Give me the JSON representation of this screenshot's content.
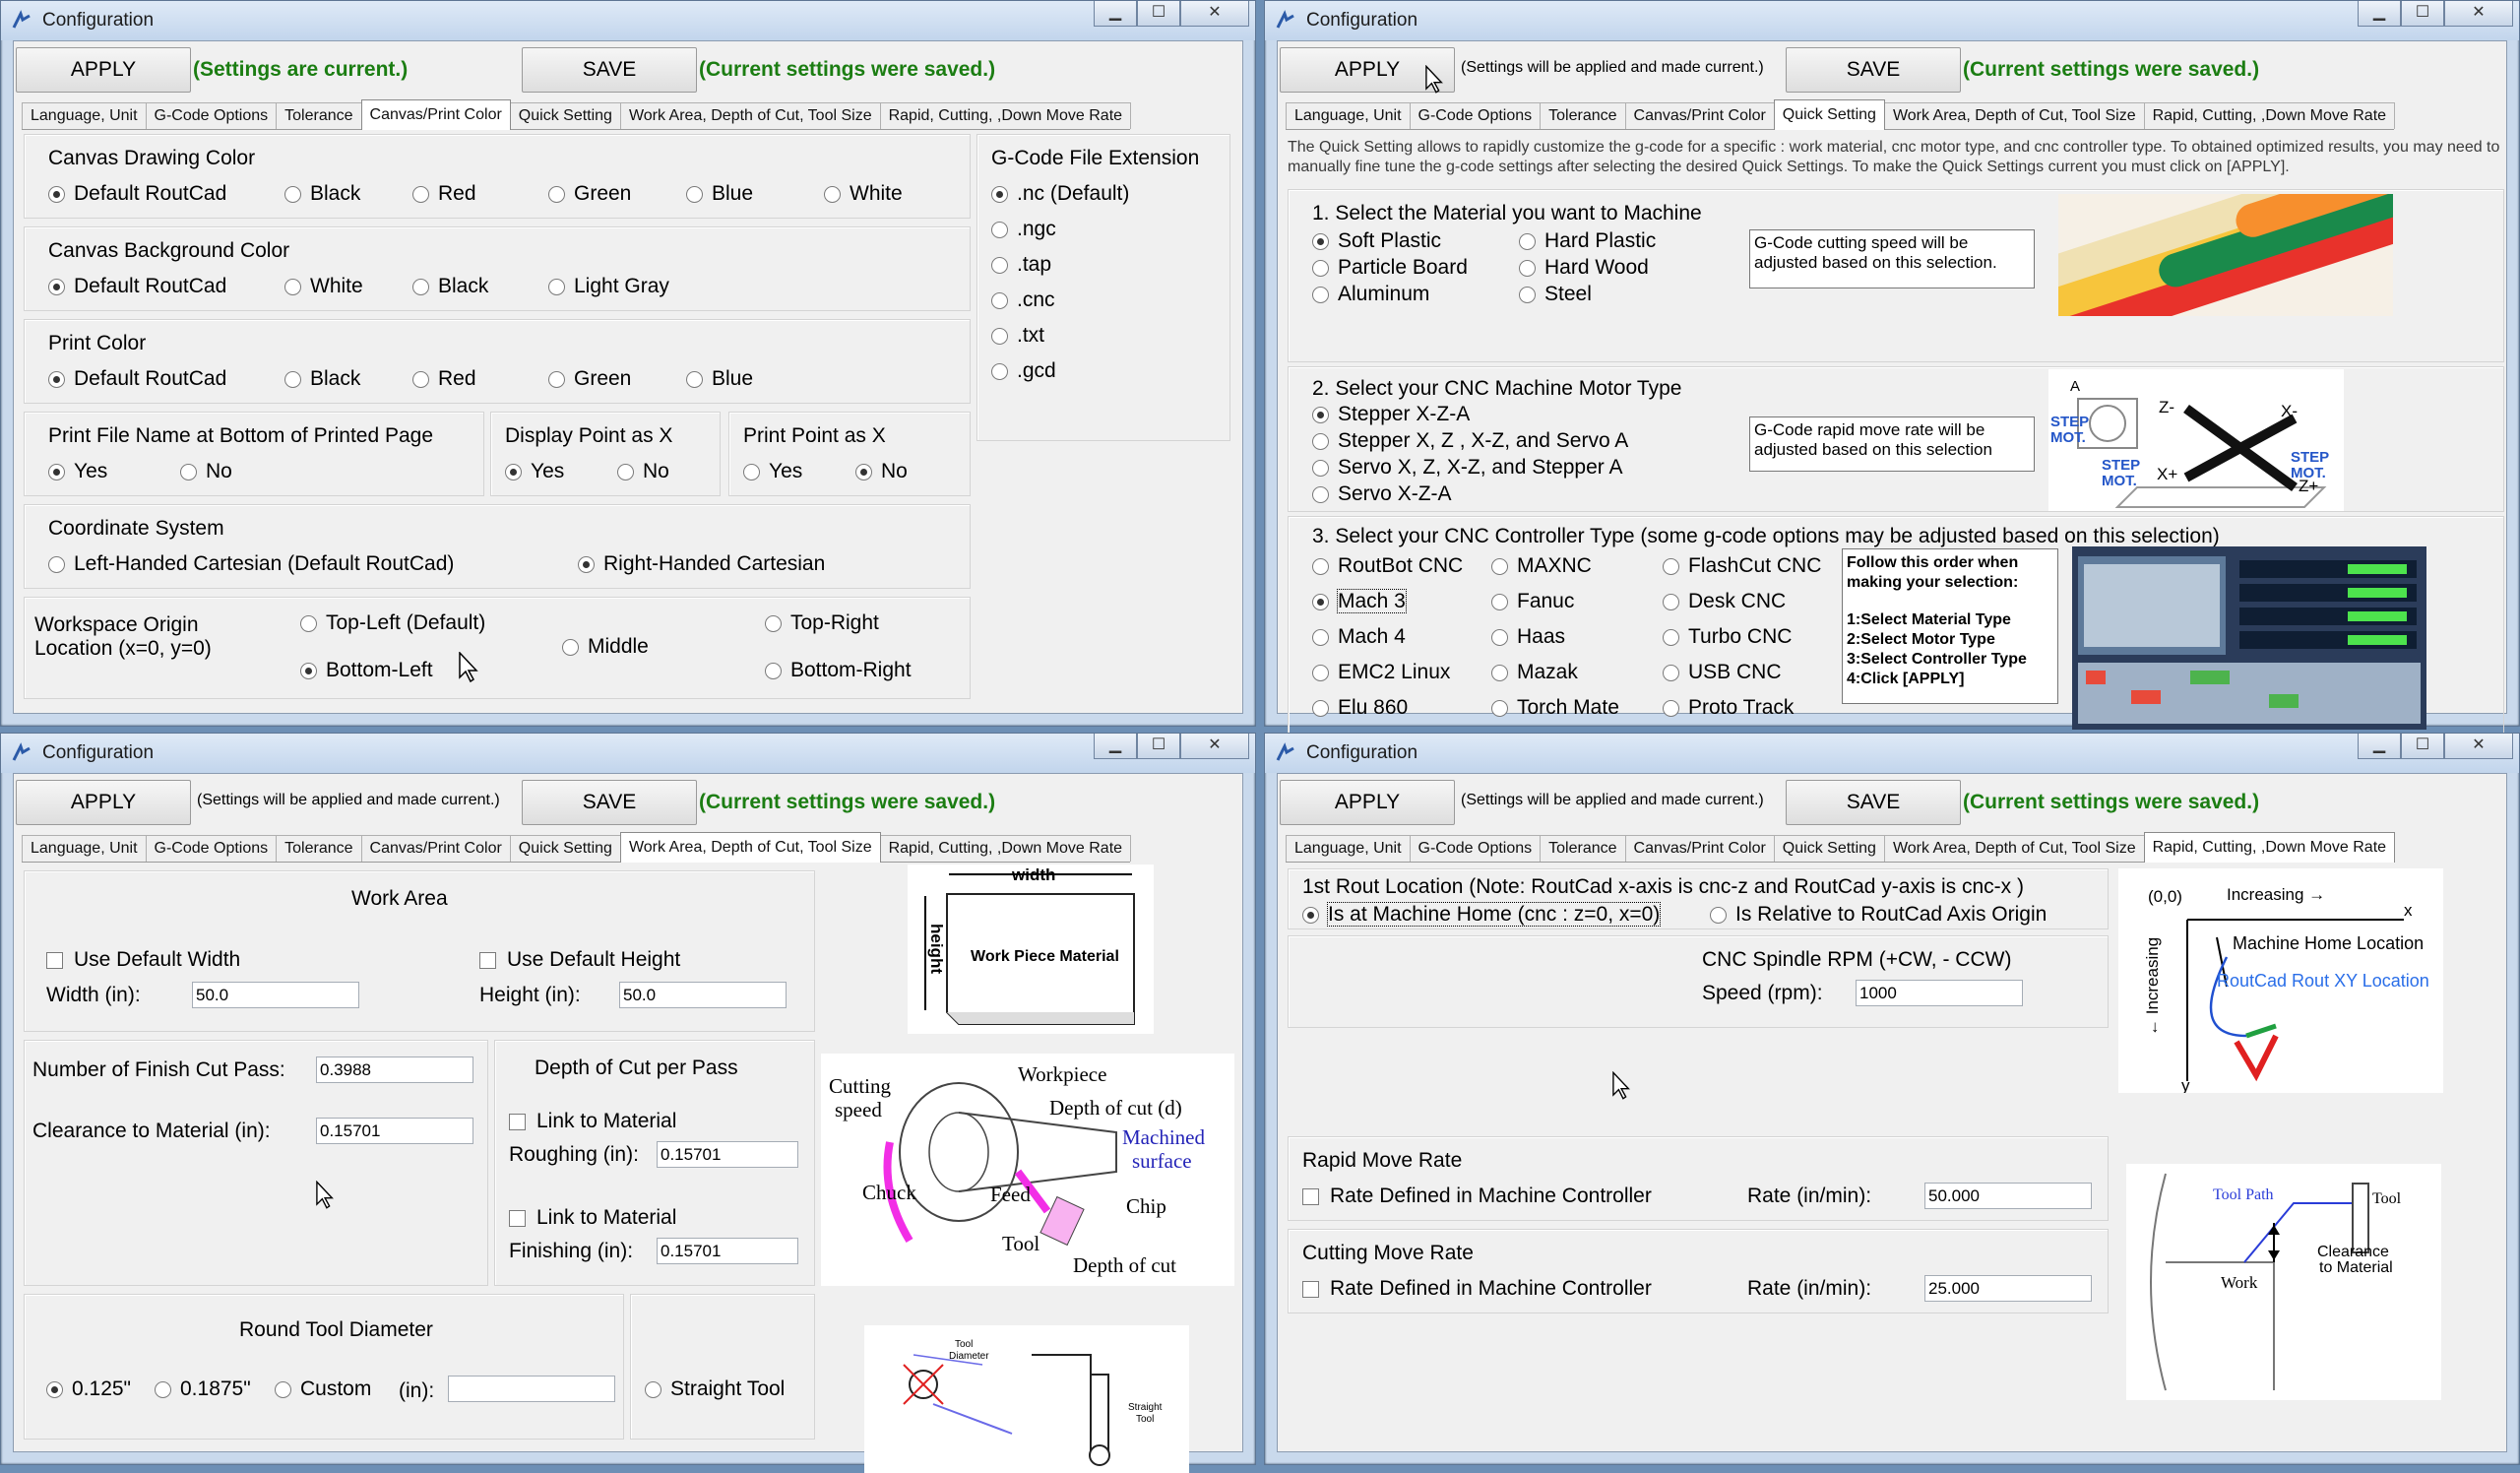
{
  "window_title": "Configuration",
  "buttons": {
    "apply": "APPLY",
    "save": "SAVE"
  },
  "status": {
    "current": "(Settings are current.)",
    "will_apply": "(Settings will be applied and made current.)",
    "saved": "(Current settings were saved.)"
  },
  "tabs": [
    "Language, Unit",
    "G-Code Options",
    "Tolerance",
    "Canvas/Print Color",
    "Quick Setting",
    "Work Area, Depth of Cut, Tool Size",
    "Rapid, Cutting, ,Down Move Rate"
  ],
  "canvas": {
    "drawing_color": {
      "title": "Canvas Drawing Color",
      "options": [
        "Default RoutCad",
        "Black",
        "Red",
        "Green",
        "Blue",
        "White"
      ]
    },
    "background_color": {
      "title": "Canvas Background Color",
      "options": [
        "Default RoutCad",
        "White",
        "Black",
        "Light Gray"
      ]
    },
    "print_color": {
      "title": "Print Color",
      "options": [
        "Default RoutCad",
        "Black",
        "Red",
        "Green",
        "Blue"
      ]
    },
    "print_filename": {
      "title": "Print File Name at Bottom of Printed Page",
      "yes": "Yes",
      "no": "No"
    },
    "display_point": {
      "title": "Display Point as X",
      "yes": "Yes",
      "no": "No"
    },
    "print_point": {
      "title": "Print Point as X",
      "yes": "Yes",
      "no": "No"
    },
    "coordinate": {
      "title": "Coordinate System",
      "left": "Left-Handed Cartesian (Default RoutCad)",
      "right": "Right-Handed Cartesian"
    },
    "origin": {
      "title1": "Workspace Origin",
      "title2": "Location  (x=0, y=0)",
      "top_left": "Top-Left (Default)",
      "middle": "Middle",
      "top_right": "Top-Right",
      "bottom_left": "Bottom-Left",
      "bottom_right": "Bottom-Right"
    },
    "extension": {
      "title": "G-Code File Extension",
      "options": [
        ".nc (Default)",
        ".ngc",
        ".tap",
        ".cnc",
        ".txt",
        ".gcd"
      ]
    }
  },
  "quick": {
    "description": "The Quick Setting allows to rapidly customize the g-code for a specific : work material, cnc motor type, and cnc controller type. To obtained optimized results, you may need to manually  fine tune the g-code settings after selecting the desired Quick Settings. To make the Quick Settings current you must click on [APPLY].",
    "material": {
      "title": "1. Select the Material you want  to Machine",
      "options": [
        "Soft Plastic",
        "Hard Plastic",
        "Particle Board",
        "Hard Wood",
        "Aluminum",
        "Steel"
      ],
      "note": "G-Code cutting speed will be adjusted based on this selection."
    },
    "motor": {
      "title": "2. Select your CNC Machine Motor Type",
      "options": [
        "Stepper X-Z-A",
        "Stepper X, Z , X-Z, and Servo A",
        "Servo X, Z, X-Z, and Stepper A",
        "Servo X-Z-A"
      ],
      "note": "G-Code rapid move rate will be adjusted based on this selection"
    },
    "motor_img": {
      "step1": "STEP",
      "mot1": "MOT.",
      "step2": "STEP",
      "mot2": "MOT.",
      "step3": "STEP",
      "mot3": "MOT.",
      "zminus": "Z-",
      "xminus": "X-",
      "xplus": "X+",
      "zplus": "Z+",
      "a": "A"
    },
    "controller": {
      "title": "3. Select your CNC Controller Type (some g-code options may be adjusted based on this selection)",
      "options": [
        "RoutBot CNC",
        "MAXNC",
        "FlashCut CNC",
        "Mach 3",
        "Fanuc",
        "Desk CNC",
        "Mach 4",
        "Haas",
        "Turbo CNC",
        "EMC2 Linux",
        "Mazak",
        "USB CNC",
        "Elu 860",
        "Torch Mate",
        "Proto Track"
      ]
    },
    "order_note": [
      "Follow this order when",
      "making your selection:",
      "",
      "1:Select Material Type",
      "2:Select Motor Type",
      "3:Select Controller Type",
      "4:Click [APPLY]"
    ]
  },
  "work": {
    "area_title": "Work Area",
    "use_default_width": "Use Default Width",
    "use_default_height": "Use Default Height",
    "width_label": "Width   (in):",
    "width": "50.0",
    "height_label": "Height (in):",
    "height": "50.0",
    "finish_label": "Number of Finish Cut Pass:",
    "finish": "0.3988",
    "clearance_label": "Clearance to Material  (in):",
    "clearance": "0.15701",
    "depth_title": "Depth of Cut per Pass",
    "link1": "Link to Material",
    "roughing_label": "Roughing (in):",
    "roughing": "0.15701",
    "link2": "Link to Material",
    "finishing_label": "Finishing  (in):",
    "finishing": "0.15701",
    "tool_title": "Round Tool Diameter",
    "tool_opts": [
      "0.125\"",
      "0.1875\"",
      "Custom"
    ],
    "custom_label": "(in):",
    "straight": "Straight Tool",
    "diagram1": {
      "width": "width",
      "height": "height",
      "material": "Work Piece Material"
    },
    "diagram2": {
      "cutting": "Cutting",
      "speed": "speed",
      "workpiece": "Workpiece",
      "depth": "Depth of cut (d)",
      "machined1": "Machined",
      "machined2": "surface",
      "chuck": "Chuck",
      "feed": "Feed",
      "chip": "Chip",
      "tool": "Tool",
      "depth2": "Depth of cut"
    },
    "diagram3": {
      "tool_diameter1": "Tool",
      "tool_diameter2": "Diameter",
      "straight1": "Straight",
      "straight2": "Tool"
    }
  },
  "rapid": {
    "rout_title": "1st Rout Location (Note: RoutCad x-axis is cnc-z and RoutCad y-axis is cnc-x )",
    "machine_home": "Is at Machine Home (cnc : z=0, x=0)",
    "relative": "Is Relative to RoutCad Axis Origin",
    "spindle_title": "CNC Spindle RPM (+CW, - CCW)",
    "speed_label": "Speed  (rpm):",
    "speed": "1000",
    "rapid_title": "Rapid Move Rate",
    "rapid_check": "Rate Defined in Machine Controller",
    "rate_label": "Rate   (in/min):",
    "rapid_rate": "50.000",
    "cutting_title": "Cutting Move Rate",
    "cutting_check": "Rate Defined in Machine Controller",
    "cutting_rate": "25.000",
    "diagram_home": {
      "origin": "(0,0)",
      "increasing": "Increasing →",
      "x": "x",
      "machine_home": "Machine Home Location",
      "routcad": "RoutCad Rout XY Location",
      "vincreasing": "← Increasing",
      "y": "y"
    },
    "diagram_tool": {
      "toolpath": "Tool Path",
      "tool": "Tool",
      "clearance1": "Clearance",
      "clearance2": "to Material",
      "work": "Work"
    }
  }
}
